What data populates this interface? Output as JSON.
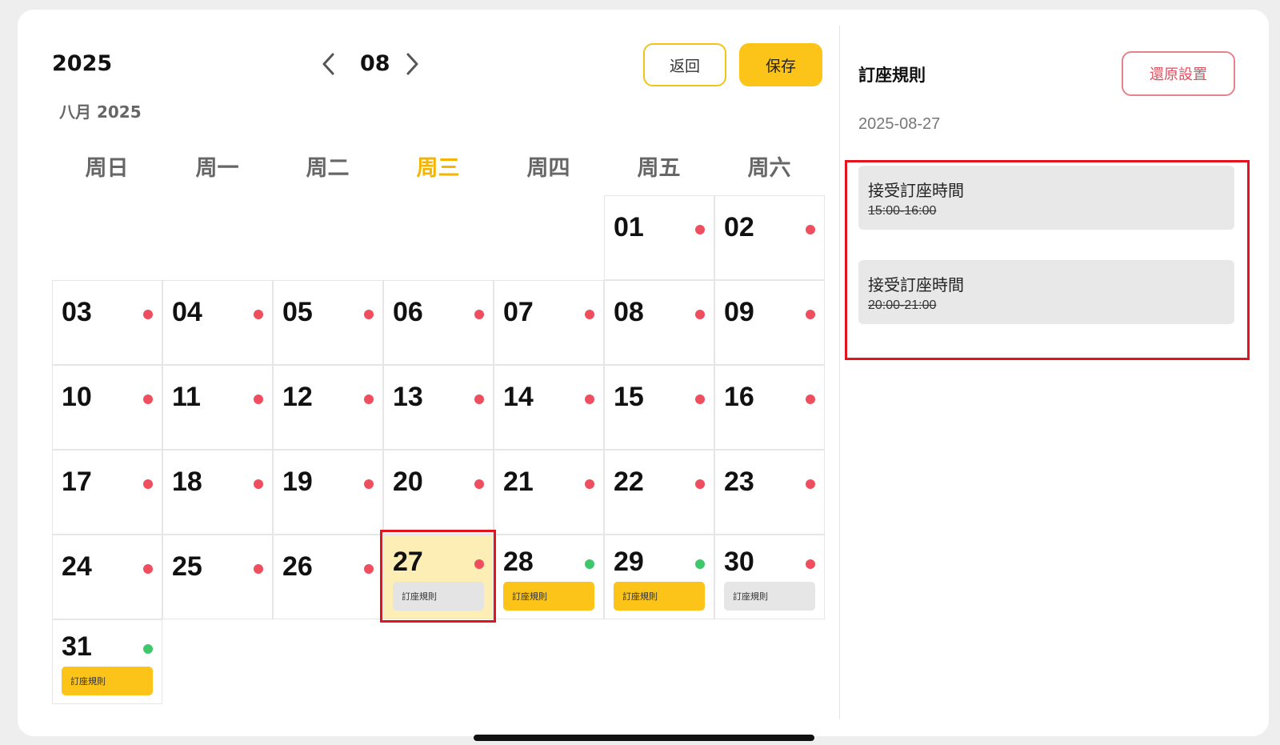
{
  "header": {
    "year": "2025",
    "month": "08",
    "subtitle": "八月 2025",
    "back_label": "返回",
    "save_label": "保存"
  },
  "weekdays": [
    "周日",
    "周一",
    "周二",
    "周三",
    "周四",
    "周五",
    "周六"
  ],
  "active_weekday_index": 3,
  "calendar": {
    "rows": [
      [
        null,
        null,
        null,
        null,
        null,
        {
          "day": "01",
          "dot": "red"
        },
        {
          "day": "02",
          "dot": "red"
        }
      ],
      [
        {
          "day": "03",
          "dot": "red"
        },
        {
          "day": "04",
          "dot": "red"
        },
        {
          "day": "05",
          "dot": "red"
        },
        {
          "day": "06",
          "dot": "red"
        },
        {
          "day": "07",
          "dot": "red"
        },
        {
          "day": "08",
          "dot": "red"
        },
        {
          "day": "09",
          "dot": "red"
        }
      ],
      [
        {
          "day": "10",
          "dot": "red"
        },
        {
          "day": "11",
          "dot": "red"
        },
        {
          "day": "12",
          "dot": "red"
        },
        {
          "day": "13",
          "dot": "red"
        },
        {
          "day": "14",
          "dot": "red"
        },
        {
          "day": "15",
          "dot": "red"
        },
        {
          "day": "16",
          "dot": "red"
        }
      ],
      [
        {
          "day": "17",
          "dot": "red"
        },
        {
          "day": "18",
          "dot": "red"
        },
        {
          "day": "19",
          "dot": "red"
        },
        {
          "day": "20",
          "dot": "red"
        },
        {
          "day": "21",
          "dot": "red"
        },
        {
          "day": "22",
          "dot": "red"
        },
        {
          "day": "23",
          "dot": "red"
        }
      ],
      [
        {
          "day": "24",
          "dot": "red"
        },
        {
          "day": "25",
          "dot": "red"
        },
        {
          "day": "26",
          "dot": "red"
        },
        {
          "day": "27",
          "dot": "red",
          "tag": "訂座規則",
          "tag_color": "gray",
          "selected": true
        },
        {
          "day": "28",
          "dot": "green",
          "tag": "訂座規則",
          "tag_color": "yellow"
        },
        {
          "day": "29",
          "dot": "green",
          "tag": "訂座規則",
          "tag_color": "yellow"
        },
        {
          "day": "30",
          "dot": "red",
          "tag": "訂座規則",
          "tag_color": "gray"
        }
      ],
      [
        {
          "day": "31",
          "dot": "green",
          "tag": "訂座規則",
          "tag_color": "yellow"
        },
        null,
        null,
        null,
        null,
        null,
        null
      ]
    ]
  },
  "colors": {
    "accent": "#fcc419",
    "dot_red": "#ee4e5e",
    "dot_green": "#3fc86b",
    "highlight": "#e3141e"
  },
  "rules_panel": {
    "title": "訂座規則",
    "reset_label": "還原設置",
    "date": "2025-08-27",
    "rules": [
      {
        "label": "接受訂座時間",
        "time": "15:00-16:00"
      },
      {
        "label": "接受訂座時間",
        "time": "20:00-21:00"
      }
    ]
  }
}
